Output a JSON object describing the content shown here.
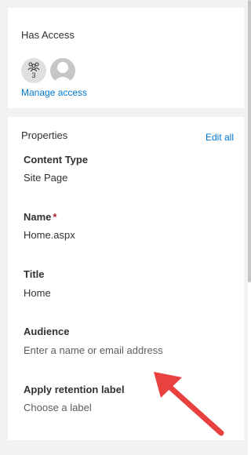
{
  "access": {
    "title": "Has Access",
    "group_avatar": {
      "icon": "group-icon",
      "count": "3"
    },
    "person_avatar": {
      "icon": "person-icon"
    },
    "manage_link": "Manage access"
  },
  "properties": {
    "title": "Properties",
    "edit_all": "Edit all",
    "fields": [
      {
        "label": "Content Type",
        "value": "Site Page"
      },
      {
        "label": "Name",
        "required_mark": "*",
        "value": "Home.aspx"
      },
      {
        "label": "Title",
        "value": "Home"
      },
      {
        "label": "Audience",
        "placeholder": "Enter a name or email address"
      },
      {
        "label": "Apply retention label",
        "placeholder": "Choose a label"
      }
    ]
  },
  "annotation": {
    "arrow_color": "#e8413f"
  }
}
